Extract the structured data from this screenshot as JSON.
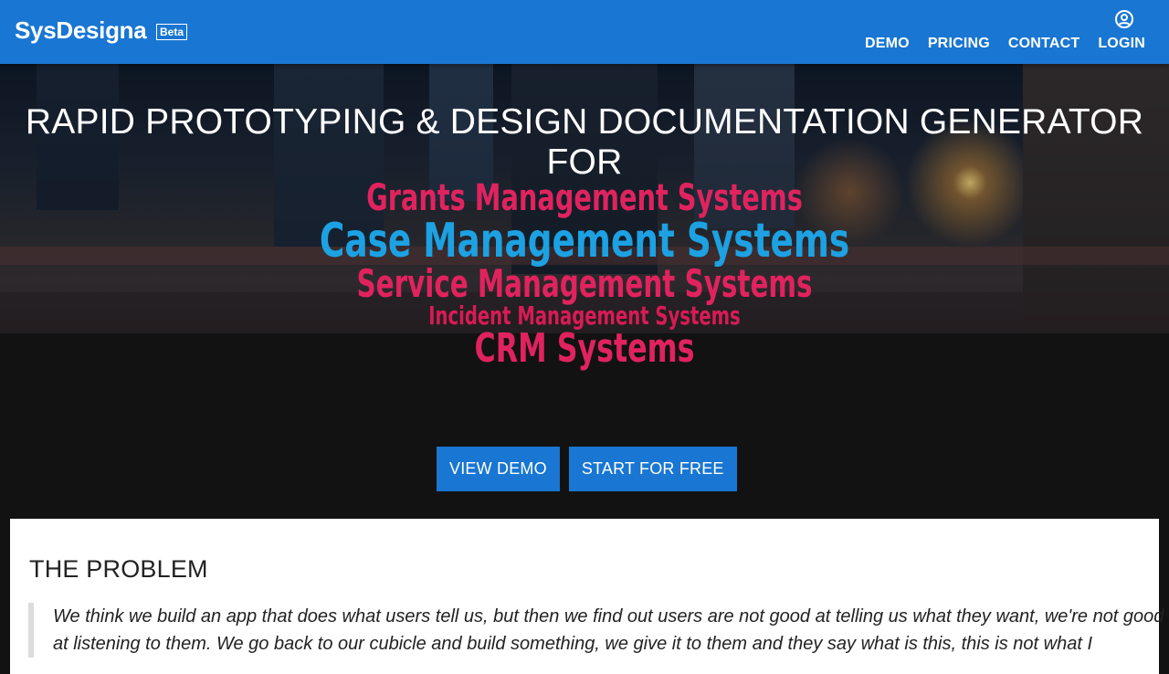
{
  "header": {
    "brand": "SysDesigna",
    "badge": "Beta",
    "nav": [
      "DEMO",
      "PRICING",
      "CONTACT",
      "LOGIN"
    ]
  },
  "hero": {
    "headline": "RAPID PROTOTYPING & DESIGN DOCUMENTATION GENERATOR FOR",
    "rotating_words": [
      "Grants Management Systems",
      "Case Management Systems",
      "Service Management Systems",
      "Incident Management Systems",
      "CRM Systems"
    ],
    "buttons": [
      "VIEW DEMO",
      "START FOR FREE"
    ]
  },
  "problem": {
    "title": "THE PROBLEM",
    "quote": "We think we build an app that does what users tell us, but then we find out users are not good at telling us what they want, we're not good at listening to them. We go back to our cubicle and build something, we give it to them and they say what is this, this is not what I"
  },
  "colors": {
    "primary": "#1976d2",
    "accent_pink": "#e0235f",
    "accent_blue": "#1da1e2"
  }
}
